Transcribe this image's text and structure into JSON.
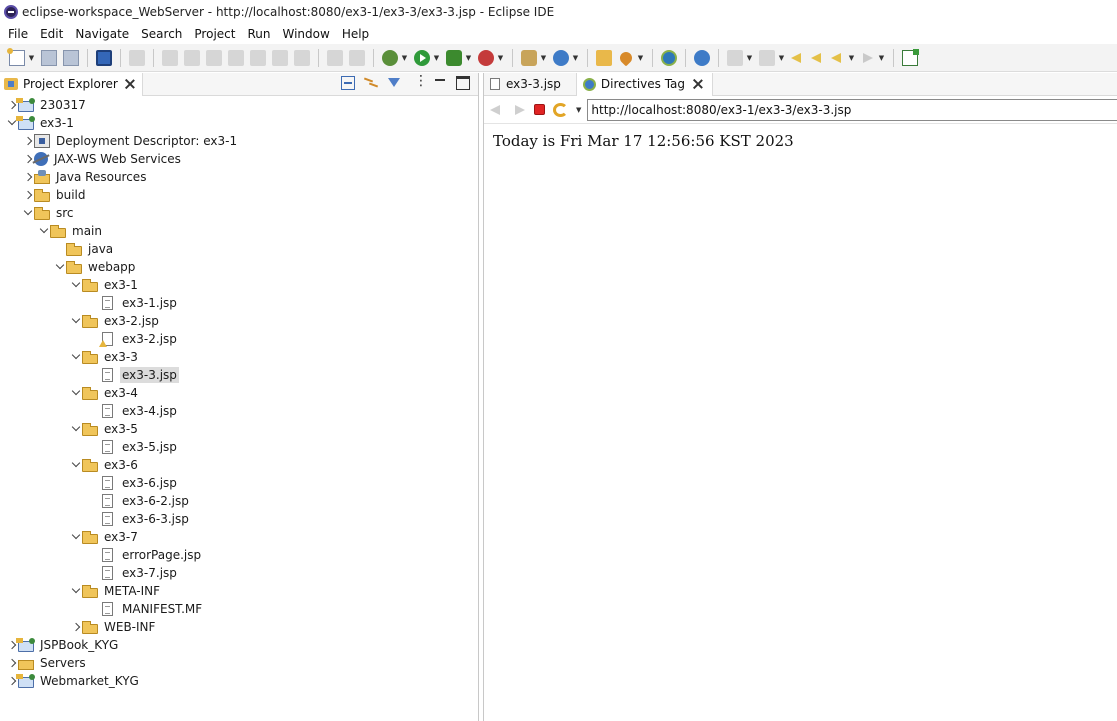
{
  "window": {
    "title": "eclipse-workspace_WebServer - http://localhost:8080/ex3-1/ex3-3/ex3-3.jsp - Eclipse IDE"
  },
  "menubar": [
    "File",
    "Edit",
    "Navigate",
    "Search",
    "Project",
    "Run",
    "Window",
    "Help"
  ],
  "project_explorer": {
    "title": "Project Explorer",
    "tree": [
      {
        "label": "230317",
        "icon": "project-icon",
        "expanded": false
      },
      {
        "label": "ex3-1",
        "icon": "project-icon",
        "expanded": true
      },
      {
        "label": "Deployment Descriptor: ex3-1",
        "icon": "deployment-descriptor-icon",
        "expanded": false
      },
      {
        "label": "JAX-WS Web Services",
        "icon": "web-services-icon",
        "expanded": false
      },
      {
        "label": "Java Resources",
        "icon": "java-resources-icon",
        "expanded": false
      },
      {
        "label": "build",
        "icon": "folder-icon",
        "expanded": false
      },
      {
        "label": "src",
        "icon": "folder-icon",
        "expanded": true
      },
      {
        "label": "main",
        "icon": "folder-icon",
        "expanded": true
      },
      {
        "label": "java",
        "icon": "folder-icon"
      },
      {
        "label": "webapp",
        "icon": "folder-icon",
        "expanded": true
      },
      {
        "label": "ex3-1",
        "icon": "folder-icon",
        "expanded": true
      },
      {
        "label": "ex3-1.jsp",
        "icon": "jsp-file-icon"
      },
      {
        "label": "ex3-2.jsp",
        "icon": "folder-icon",
        "expanded": true
      },
      {
        "label": "ex3-2.jsp",
        "icon": "jsp-warning-file-icon"
      },
      {
        "label": "ex3-3",
        "icon": "folder-icon",
        "expanded": true
      },
      {
        "label": "ex3-3.jsp",
        "icon": "jsp-file-icon",
        "selected": true
      },
      {
        "label": "ex3-4",
        "icon": "folder-icon",
        "expanded": true
      },
      {
        "label": "ex3-4.jsp",
        "icon": "jsp-file-icon"
      },
      {
        "label": "ex3-5",
        "icon": "folder-icon",
        "expanded": true
      },
      {
        "label": "ex3-5.jsp",
        "icon": "jsp-file-icon"
      },
      {
        "label": "ex3-6",
        "icon": "folder-icon",
        "expanded": true
      },
      {
        "label": "ex3-6.jsp",
        "icon": "jsp-file-icon"
      },
      {
        "label": "ex3-6-2.jsp",
        "icon": "jsp-file-icon"
      },
      {
        "label": "ex3-6-3.jsp",
        "icon": "jsp-file-icon"
      },
      {
        "label": "ex3-7",
        "icon": "folder-icon",
        "expanded": true
      },
      {
        "label": "errorPage.jsp",
        "icon": "jsp-file-icon"
      },
      {
        "label": "ex3-7.jsp",
        "icon": "jsp-file-icon"
      },
      {
        "label": "META-INF",
        "icon": "folder-icon",
        "expanded": true
      },
      {
        "label": "MANIFEST.MF",
        "icon": "file-icon"
      },
      {
        "label": "WEB-INF",
        "icon": "folder-icon",
        "expanded": false
      },
      {
        "label": "JSPBook_KYG",
        "icon": "project-icon",
        "expanded": false
      },
      {
        "label": "Servers",
        "icon": "servers-folder-icon",
        "expanded": false
      },
      {
        "label": "Webmarket_KYG",
        "icon": "project-icon",
        "expanded": false
      }
    ]
  },
  "editor": {
    "tabs": [
      {
        "label": "ex3-3.jsp",
        "active": false
      },
      {
        "label": "Directives Tag",
        "active": true
      }
    ],
    "url": "http://localhost:8080/ex3-1/ex3-3/ex3-3.jsp",
    "page_text": "Today is Fri Mar 17 12:56:56 KST 2023"
  }
}
